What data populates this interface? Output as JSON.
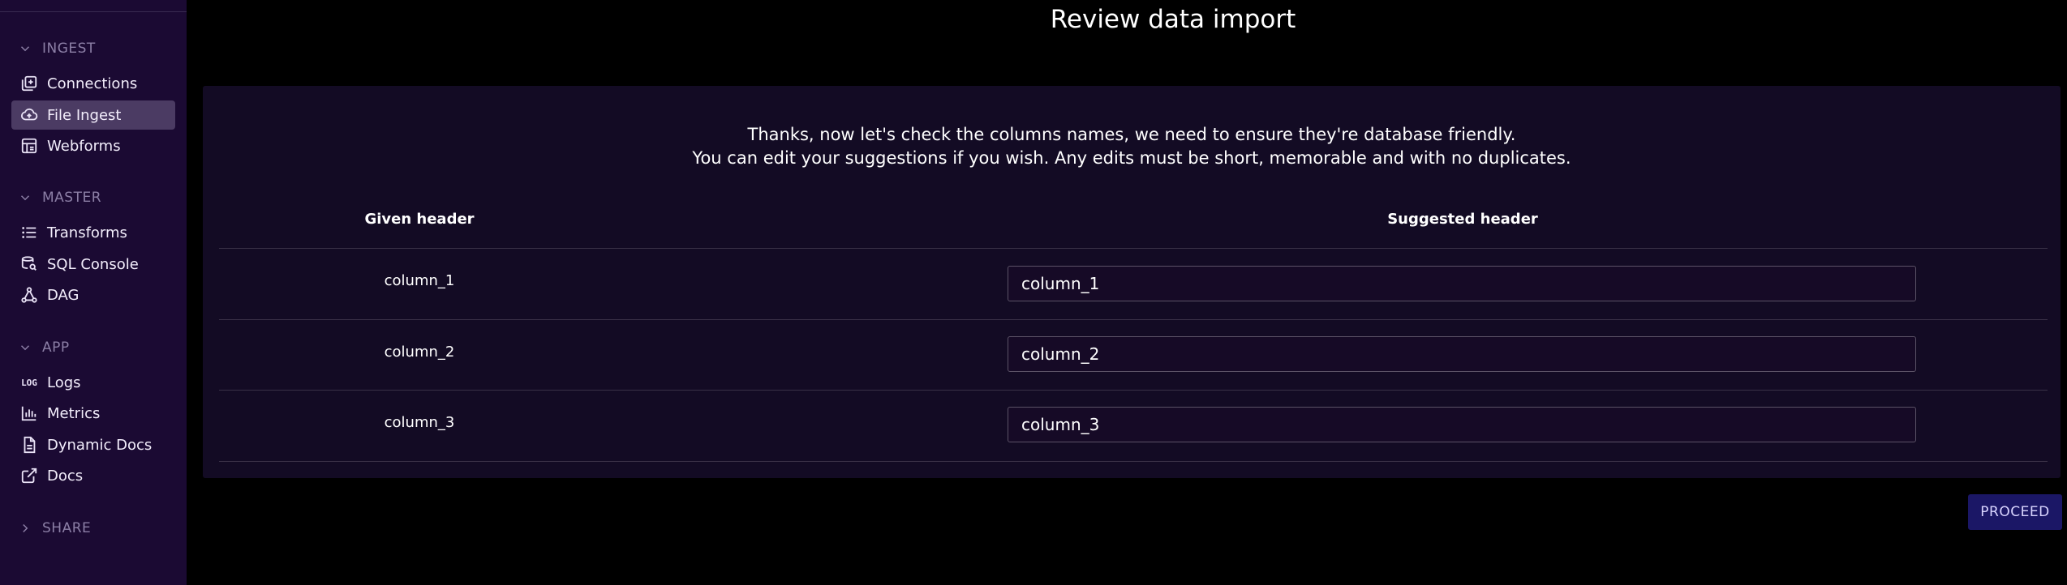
{
  "sidebar": {
    "sections": [
      {
        "label": "INGEST",
        "expanded": true
      },
      {
        "label": "MASTER",
        "expanded": true
      },
      {
        "label": "APP",
        "expanded": true
      },
      {
        "label": "SHARE",
        "expanded": false
      }
    ],
    "items": [
      {
        "label": "Connections",
        "icon": "connections-icon",
        "active": false
      },
      {
        "label": "File Ingest",
        "icon": "cloud-upload-icon",
        "active": true
      },
      {
        "label": "Webforms",
        "icon": "form-icon",
        "active": false
      },
      {
        "label": "Transforms",
        "icon": "list-icon",
        "active": false
      },
      {
        "label": "SQL Console",
        "icon": "database-search-icon",
        "active": false
      },
      {
        "label": "DAG",
        "icon": "graph-icon",
        "active": false
      },
      {
        "label": "Logs",
        "icon": "log-icon",
        "icon_text": "LOG",
        "active": false
      },
      {
        "label": "Metrics",
        "icon": "bar-chart-icon",
        "active": false
      },
      {
        "label": "Dynamic Docs",
        "icon": "document-icon",
        "active": false
      },
      {
        "label": "Docs",
        "icon": "external-link-icon",
        "active": false
      }
    ]
  },
  "main": {
    "title": "Review data import",
    "intro_line1": "Thanks, now let's check the columns names, we need to ensure they're database friendly.",
    "intro_line2": "You can edit your suggestions if you wish. Any edits must be short, memorable and with no duplicates.",
    "headers": {
      "given": "Given header",
      "suggested": "Suggested header"
    },
    "rows": [
      {
        "given": "column_1",
        "suggested": "column_1"
      },
      {
        "given": "column_2",
        "suggested": "column_2"
      },
      {
        "given": "column_3",
        "suggested": "column_3"
      }
    ],
    "proceed_label": "PROCEED"
  },
  "colors": {
    "sidebar_bg": "#1b0a33",
    "active_item_bg": "#4b3b63",
    "card_bg": "#130b24",
    "proceed_bg": "#1b1766"
  }
}
